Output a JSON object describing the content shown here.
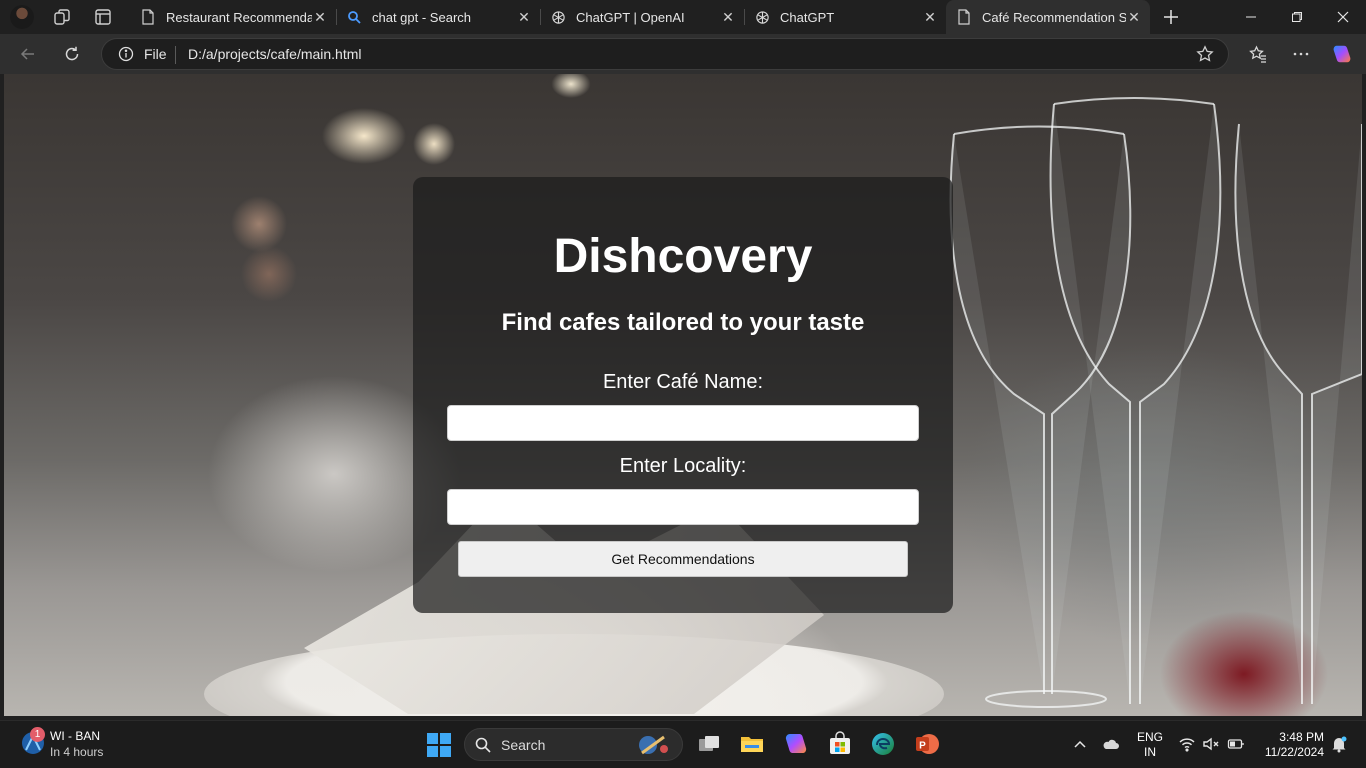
{
  "browser": {
    "tabs": [
      {
        "title": "Restaurant Recommendatio",
        "favicon": "page-icon",
        "active": false
      },
      {
        "title": "chat gpt - Search",
        "favicon": "search-icon",
        "active": false
      },
      {
        "title": "ChatGPT | OpenAI",
        "favicon": "openai-icon",
        "active": false
      },
      {
        "title": "ChatGPT",
        "favicon": "openai-icon",
        "active": false
      },
      {
        "title": "Café Recommendation Sys",
        "favicon": "page-icon",
        "active": true
      }
    ],
    "address": {
      "scheme_label": "File",
      "url": "D:/a/projects/cafe/main.html"
    }
  },
  "page": {
    "title": "Dishcovery",
    "subtitle": "Find cafes tailored to your taste",
    "cafe_label": "Enter Café Name:",
    "cafe_value": "",
    "locality_label": "Enter Locality:",
    "locality_value": "",
    "button_label": "Get Recommendations"
  },
  "taskbar": {
    "widget": {
      "title": "WI - BAN",
      "subtitle": "In 4 hours",
      "badge": "1"
    },
    "search_placeholder": "Search",
    "apps": [
      "task-view",
      "file-explorer",
      "copilot",
      "microsoft-store",
      "edge",
      "powerpoint"
    ],
    "tray": {
      "lang_line1": "ENG",
      "lang_line2": "IN",
      "time": "3:48 PM",
      "date": "11/22/2024"
    }
  },
  "colors": {
    "accent": "#4cc2ff",
    "card_bg": "rgba(28,28,28,0.72)",
    "badge": "#e35d6a"
  }
}
